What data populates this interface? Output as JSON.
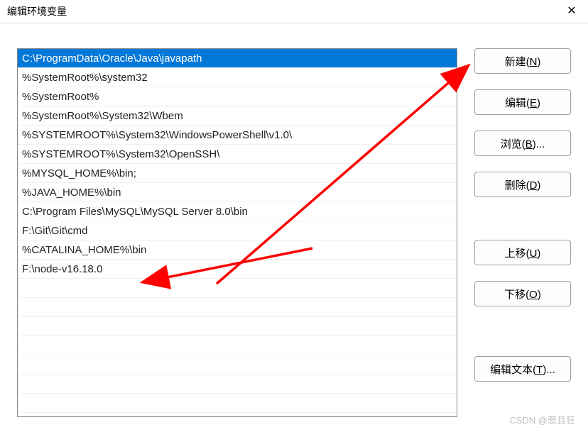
{
  "window": {
    "title": "编辑环境变量"
  },
  "list": {
    "items": [
      "C:\\ProgramData\\Oracle\\Java\\javapath",
      "%SystemRoot%\\system32",
      "%SystemRoot%",
      "%SystemRoot%\\System32\\Wbem",
      "%SYSTEMROOT%\\System32\\WindowsPowerShell\\v1.0\\",
      "%SYSTEMROOT%\\System32\\OpenSSH\\",
      "%MYSQL_HOME%\\bin;",
      "%JAVA_HOME%\\bin",
      "C:\\Program Files\\MySQL\\MySQL Server 8.0\\bin",
      "F:\\Git\\Git\\cmd",
      "%CATALINA_HOME%\\bin",
      "F:\\node-v16.18.0"
    ],
    "selected_index": 0
  },
  "buttons": {
    "new": {
      "label": "新建(",
      "key": "N",
      "suffix": ")"
    },
    "edit": {
      "label": "编辑(",
      "key": "E",
      "suffix": ")"
    },
    "browse": {
      "label": "浏览(",
      "key": "B",
      "suffix": ")..."
    },
    "delete": {
      "label": "删除(",
      "key": "D",
      "suffix": ")"
    },
    "up": {
      "label": "上移(",
      "key": "U",
      "suffix": ")"
    },
    "down": {
      "label": "下移(",
      "key": "O",
      "suffix": ")"
    },
    "edit_text": {
      "label": "编辑文本(",
      "key": "T",
      "suffix": ")..."
    }
  },
  "watermark": "CSDN @悲且狂",
  "annotations": {
    "arrow_color": "#ff0000"
  }
}
